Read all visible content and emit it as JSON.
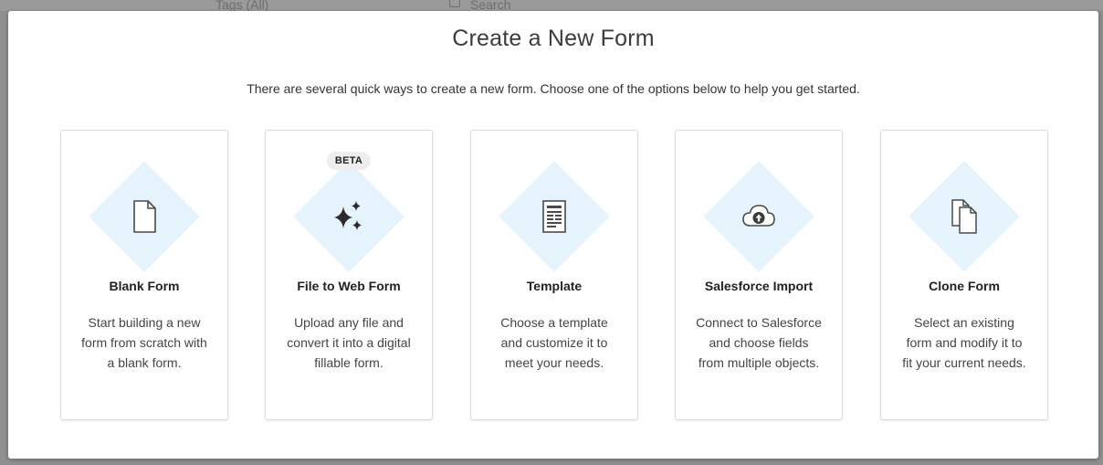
{
  "background": {
    "tags_label": "Tags (All)",
    "search_placeholder": "Search"
  },
  "modal": {
    "title": "Create a New Form",
    "subtitle": "There are several quick ways to create a new form. Choose one of the options below to help you get started."
  },
  "options": [
    {
      "title": "Blank Form",
      "description": "Start building a new form from scratch with a blank form.",
      "icon": "blank-document-icon"
    },
    {
      "title": "File to Web Form",
      "description": "Upload any file and convert it into a digital fillable form.",
      "icon": "sparkles-icon",
      "badge": "BETA"
    },
    {
      "title": "Template",
      "description": "Choose a template and customize it to meet your needs.",
      "icon": "template-document-icon"
    },
    {
      "title": "Salesforce Import",
      "description": "Connect to Salesforce and choose fields from multiple objects.",
      "icon": "cloud-upload-icon"
    },
    {
      "title": "Clone Form",
      "description": "Select an existing form and modify it to fit your current needs.",
      "icon": "copy-documents-icon"
    }
  ],
  "colors": {
    "diamond_background": "#e5f3fd",
    "icon_stroke": "#4a4a4a",
    "card_border": "#dcdcdc"
  }
}
